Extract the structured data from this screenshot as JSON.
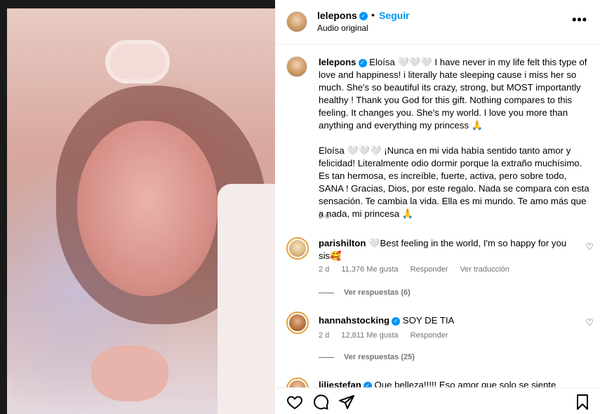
{
  "post": {
    "username": "lelepons",
    "follow_label": "Seguir",
    "audio_label": "Audio original",
    "more_icon": "more-horizontal-icon",
    "caption_en": "Eloísa 🤍🤍🤍 I have never in my life felt this type of love and happiness! i literally hate sleeping cause i miss her so much. She's so beautiful its crazy, strong, but MOST importantly healthy ! Thank you God for this gift. Nothing compares to this feeling. It changes you. She's my world. I love you more than anything and everything my princess 🙏",
    "caption_es": "Eloísa 🤍🤍🤍 ¡Nunca en mi vida había sentido tanto amor y felicidad! Literalmente odio dormir porque la extraño muchísimo. Es tan hermosa, es increíble, fuerte, activa, pero sobre todo, SANA ! Gracias, Dios, por este regalo. Nada se compara con esta sensación. Te cambia la vida. Ella es mi mundo. Te amo más que a nada, mi princesa 🙏",
    "time": "2 d",
    "verified_color": "#0095f6",
    "accent_color": "#0095f6"
  },
  "comments": [
    {
      "username": "parishilton",
      "text": "🤍Best feeling in the world, I'm so happy for you sis🥰",
      "time": "2 d",
      "likes": "11,376 Me gusta",
      "reply_label": "Responder",
      "translate_label": "Ver traducción",
      "view_replies": "Ver respuestas (6)"
    },
    {
      "username": "hannahstocking",
      "text": "SOY DE TIA",
      "time": "2 d",
      "likes": "12,811 Me gusta",
      "reply_label": "Responder",
      "view_replies": "Ver respuestas (25)"
    },
    {
      "username": "liliestefan",
      "text": "Que belleza!!!!! Eso amor que solo se siente por"
    }
  ]
}
